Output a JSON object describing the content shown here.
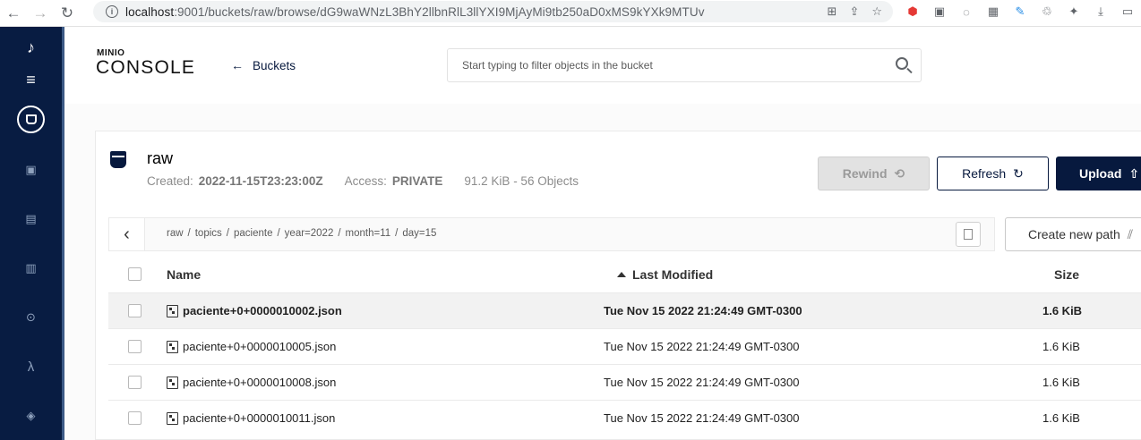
{
  "browser": {
    "url_host": "localhost",
    "url_rest": ":9001/buckets/raw/browse/dG9waWNzL3BhY2llbnRlL3llYXI9MjAyMi9tb250aD0xMS9kYXk9MTUv"
  },
  "app": {
    "logo_top": "MINIO",
    "logo_bottom": "CONSOLE",
    "back_label": "Buckets",
    "search_placeholder": "Start typing to filter objects in the bucket"
  },
  "sidebar": {
    "items": [
      "menu-icon",
      "buckets-icon",
      "identity-icon",
      "access-icon",
      "monitoring-icon",
      "diagnostics-icon",
      "lambda-icon",
      "tiers-icon"
    ]
  },
  "bucket": {
    "name": "raw",
    "created_label": "Created:",
    "created_value": "2022-11-15T23:23:00Z",
    "access_label": "Access:",
    "access_value": "PRIVATE",
    "usage": "91.2 KiB - 56 Objects"
  },
  "actions": {
    "rewind": "Rewind",
    "refresh": "Refresh",
    "upload": "Upload",
    "new_path": "Create new path"
  },
  "breadcrumb": [
    "raw",
    "topics",
    "paciente",
    "year=2022",
    "month=11",
    "day=15"
  ],
  "table": {
    "headers": {
      "name": "Name",
      "modified": "Last Modified",
      "size": "Size"
    },
    "rows": [
      {
        "name": "paciente+0+0000010002.json",
        "modified": "Tue Nov 15 2022 21:24:49 GMT-0300",
        "size": "1.6 KiB"
      },
      {
        "name": "paciente+0+0000010005.json",
        "modified": "Tue Nov 15 2022 21:24:49 GMT-0300",
        "size": "1.6 KiB"
      },
      {
        "name": "paciente+0+0000010008.json",
        "modified": "Tue Nov 15 2022 21:24:49 GMT-0300",
        "size": "1.6 KiB"
      },
      {
        "name": "paciente+0+0000010011.json",
        "modified": "Tue Nov 15 2022 21:24:49 GMT-0300",
        "size": "1.6 KiB"
      }
    ]
  },
  "colors": {
    "primary": "#07193e",
    "sidebar": "#081c42",
    "disabled": "#e2e2e2"
  }
}
